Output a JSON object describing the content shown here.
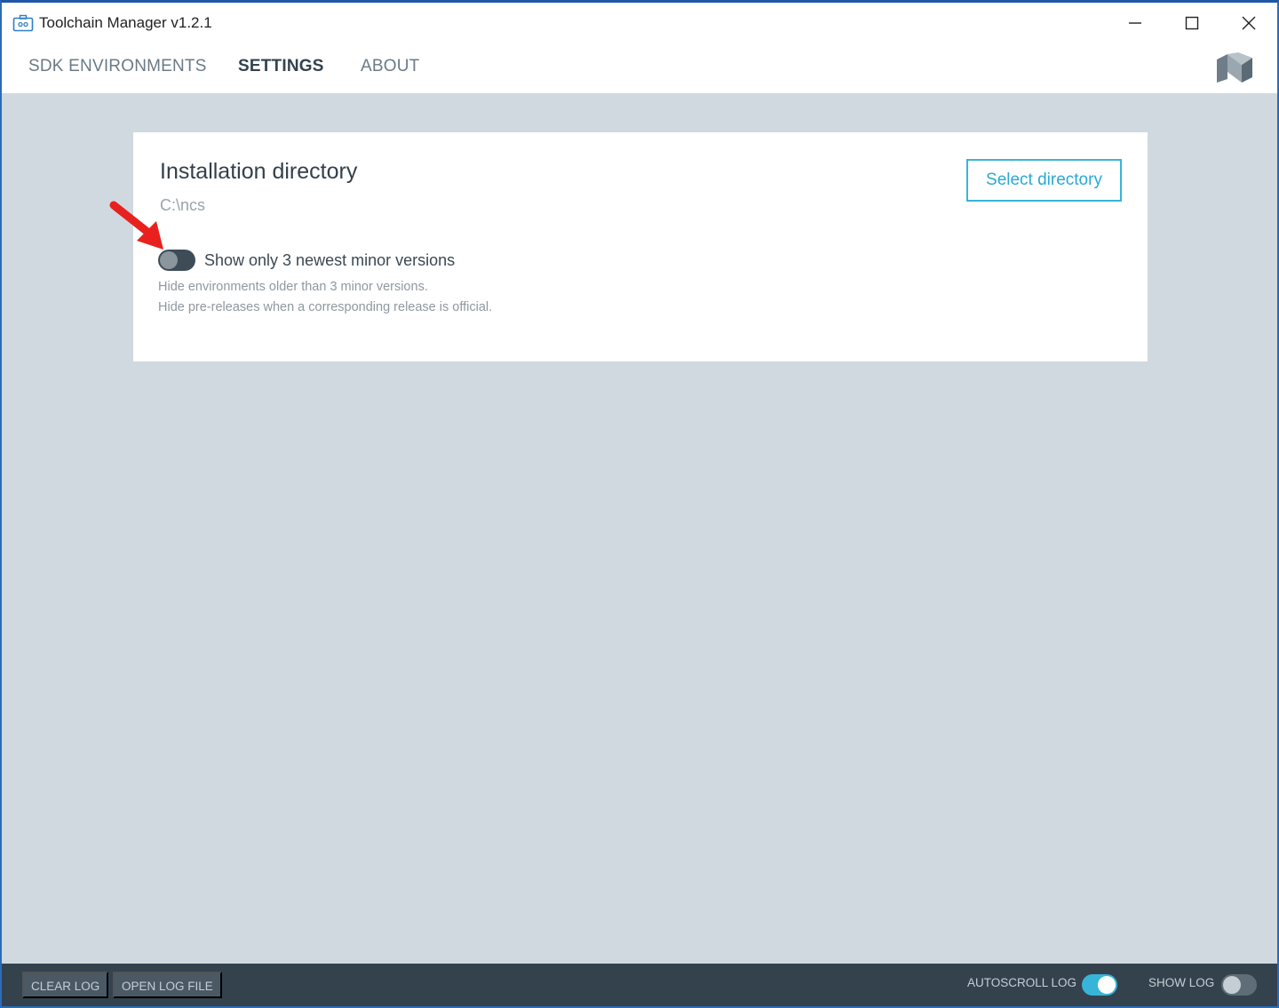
{
  "window": {
    "title": "Toolchain Manager v1.2.1",
    "controls": [
      "minimize",
      "maximize",
      "close"
    ]
  },
  "nav": {
    "tabs": [
      {
        "label": "SDK ENVIRONMENTS",
        "active": false
      },
      {
        "label": "SETTINGS",
        "active": true
      },
      {
        "label": "ABOUT",
        "active": false
      }
    ],
    "logo_icon": "nordic-logo-icon"
  },
  "settings": {
    "install_title": "Installation directory",
    "install_path": "C:\\ncs",
    "select_button": "Select directory",
    "toggle_label": "Show only 3 newest minor versions",
    "toggle_on": false,
    "hint_1": "Hide environments older than 3 minor versions.",
    "hint_2": "Hide pre-releases when a corresponding release is official."
  },
  "footer": {
    "clear_log": "CLEAR LOG",
    "open_log_file": "OPEN LOG FILE",
    "autoscroll_label": "AUTOSCROLL LOG",
    "autoscroll_on": true,
    "show_log_label": "SHOW LOG",
    "show_log_on": false
  },
  "colors": {
    "accent": "#37b5d8",
    "background": "#d0d9df",
    "footer": "#34424e",
    "annotation_arrow": "#e8211f"
  }
}
